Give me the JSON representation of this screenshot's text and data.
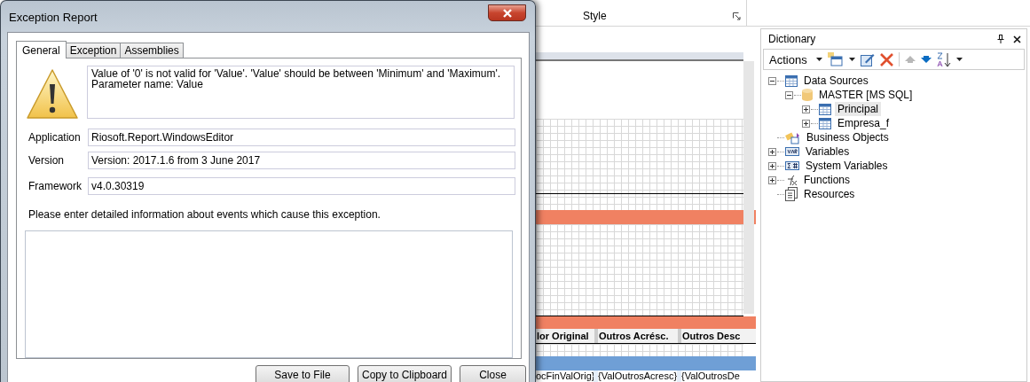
{
  "ribbon": {
    "group_label": "Style"
  },
  "designer": {
    "header_cells": [
      "lor Original",
      "Outros Acrésc.",
      "Outros Desc"
    ],
    "data_cells": [
      "ocFinValOrig}",
      "{ValOutrosAcresc}",
      "{ValOutrosDe"
    ]
  },
  "dictionary": {
    "title": "Dictionary",
    "actions_label": "Actions",
    "tree": [
      {
        "label": "Data Sources",
        "kind": "table",
        "expanded": true,
        "selected": false,
        "children": [
          {
            "label": "MASTER [MS SQL]",
            "kind": "database",
            "expanded": true,
            "selected": false,
            "children": [
              {
                "label": "Principal",
                "kind": "table",
                "expanded": false,
                "selected": true
              },
              {
                "label": "Empresa_f",
                "kind": "table",
                "expanded": false,
                "selected": false
              }
            ]
          }
        ]
      },
      {
        "label": "Business Objects",
        "kind": "business",
        "selected": false
      },
      {
        "label": "Variables",
        "kind": "variables",
        "expanded": false,
        "selected": false
      },
      {
        "label": "System Variables",
        "kind": "sysvars",
        "expanded": false,
        "selected": false
      },
      {
        "label": "Functions",
        "kind": "function",
        "expanded": false,
        "selected": false
      },
      {
        "label": "Resources",
        "kind": "resources",
        "selected": false
      }
    ]
  },
  "dialog": {
    "title": "Exception Report",
    "tabs": [
      {
        "label": "General",
        "selected": true
      },
      {
        "label": "Exception",
        "selected": false
      },
      {
        "label": "Assemblies",
        "selected": false
      }
    ],
    "message": [
      "Value of '0' is not valid for 'Value'. 'Value' should be between 'Minimum' and 'Maximum'.",
      "Parameter name: Value"
    ],
    "fields": [
      {
        "label": "Application",
        "value": "Riosoft.Report.WindowsEditor"
      },
      {
        "label": "Version",
        "value": "Version: 2017.1.6 from 3 June 2017"
      },
      {
        "label": "Framework",
        "value": "v4.0.30319"
      }
    ],
    "hint": "Please enter detailed information about events which cause this exception.",
    "buttons": [
      "Save to File",
      "Copy to Clipboard",
      "Close"
    ]
  }
}
